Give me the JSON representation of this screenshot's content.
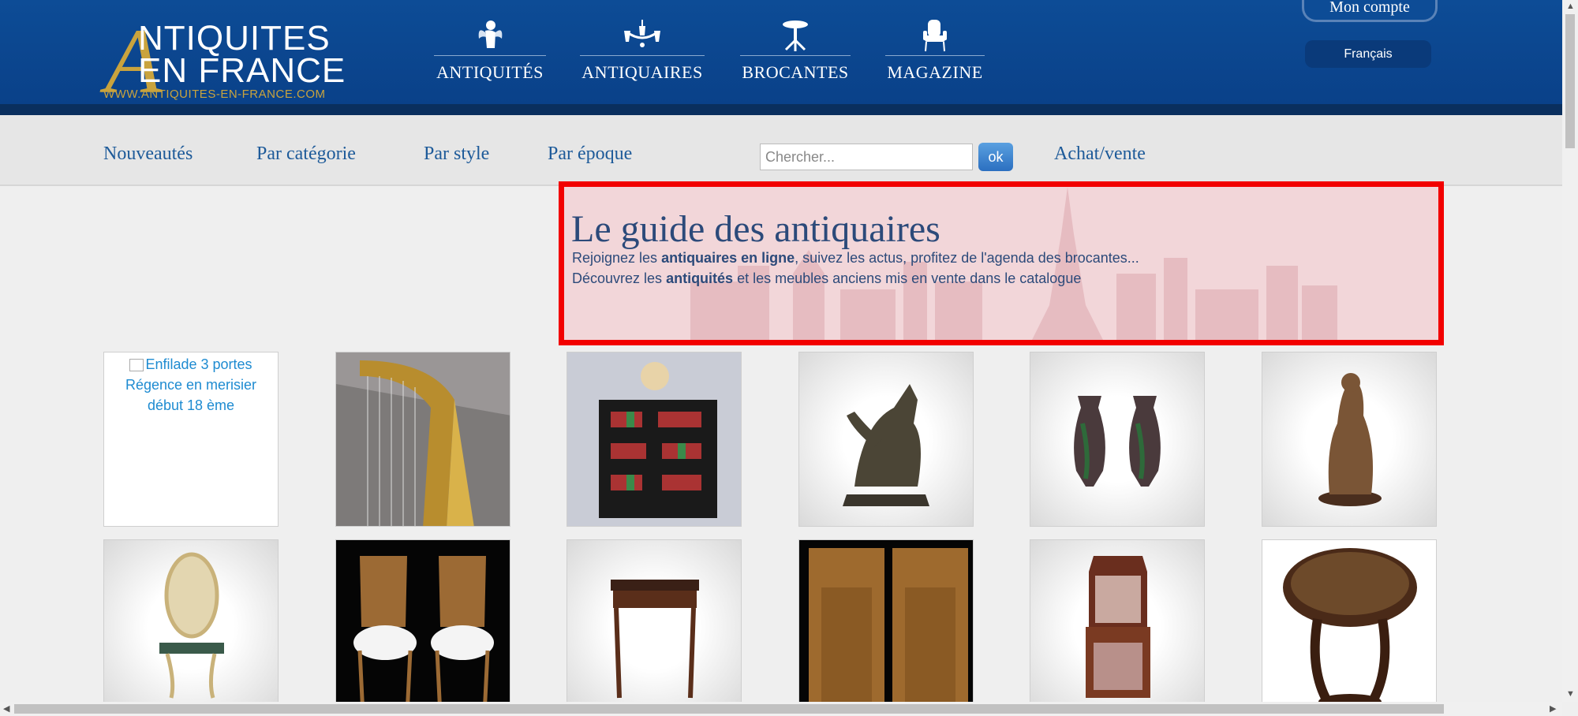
{
  "header": {
    "logo": {
      "big_letter": "A",
      "line1": "NTIQUITES",
      "line2": "EN FRANCE",
      "url": "WWW.ANTIQUITES-EN-FRANCE.COM"
    },
    "nav": [
      {
        "label": "ANTIQUITÉS",
        "icon": "cherub-icon"
      },
      {
        "label": "ANTIQUAIRES",
        "icon": "chandelier-icon"
      },
      {
        "label": "BROCANTES",
        "icon": "gueridon-table-icon"
      },
      {
        "label": "MAGAZINE",
        "icon": "armchair-icon"
      }
    ],
    "account_label": "Mon compte",
    "language": "Français"
  },
  "subnav": {
    "links": [
      "Nouveautés",
      "Par catégorie",
      "Par style",
      "Par époque"
    ],
    "search_placeholder": "Chercher...",
    "search_button": "ok",
    "extra_link": "Achat/vente"
  },
  "banner": {
    "title": "Le guide des antiquaires",
    "line1": {
      "pre": "Rejoignez les ",
      "bold": "antiquaires en ligne",
      "post": ", suivez les actus, profitez de l'agenda des brocantes..."
    },
    "line2": {
      "pre": "Découvrez les ",
      "bold": "antiquités",
      "post": " et les meubles anciens mis en vente dans le catalogue"
    }
  },
  "grid": {
    "broken_image_alt": "Enfilade 3 portes Régence en merisier début 18 ème",
    "items": [
      "enfilade",
      "harp",
      "bookcase-globe",
      "bronze-horse",
      "pair-vases",
      "bronze-sculpture",
      "mirror-console",
      "pair-chairs",
      "writing-desk",
      "wardrobe",
      "display-cabinet",
      "round-table"
    ]
  },
  "colors": {
    "header_blue": "#0d4c96",
    "gold": "#c9a33d",
    "link_blue": "#1d5a99",
    "highlight_red": "#f20000"
  }
}
